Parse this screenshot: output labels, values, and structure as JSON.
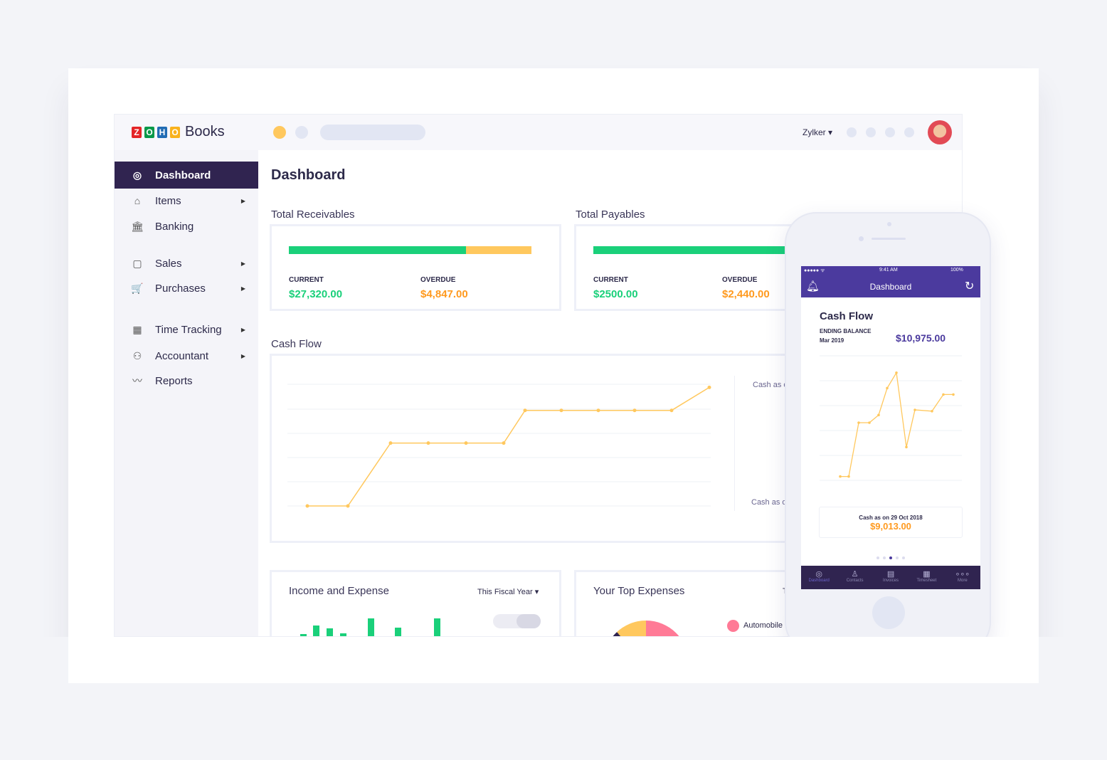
{
  "header": {
    "logo_letters": [
      "Z",
      "O",
      "H",
      "O"
    ],
    "logo_product": "Books",
    "org": "Zylker ▾"
  },
  "colors": {
    "brand_dark": "#302450",
    "green": "#1ad07a",
    "amber": "#ffc85e",
    "orange": "#ff9a1f",
    "phone_purple": "#4b3a9e",
    "pink": "#ff7a96"
  },
  "sidebar": {
    "items": [
      {
        "label": "Dashboard",
        "icon": "dashboard-icon",
        "glyph": "◎",
        "active": true
      },
      {
        "label": "Items",
        "icon": "basket-icon",
        "glyph": "⌂",
        "chevron": true
      },
      {
        "label": "Banking",
        "icon": "bank-icon",
        "glyph": "🏛"
      },
      {
        "label": "Sales",
        "icon": "bag-icon",
        "glyph": "▢",
        "chevron": true
      },
      {
        "label": "Purchases",
        "icon": "cart-icon",
        "glyph": "🛒",
        "chevron": true
      },
      {
        "label": "Time Tracking",
        "icon": "calendar-icon",
        "glyph": "▦",
        "chevron": true
      },
      {
        "label": "Accountant",
        "icon": "person-icon",
        "glyph": "⚇",
        "chevron": true
      },
      {
        "label": "Reports",
        "icon": "chart-icon",
        "glyph": "〰"
      }
    ]
  },
  "main": {
    "title": "Dashboard",
    "receivables": {
      "label": "Total Receivables",
      "current_label": "CURRENT",
      "current": "$27,320.00",
      "overdue_label": "OVERDUE",
      "overdue": "$4,847.00",
      "current_fraction": 0.73
    },
    "payables": {
      "label": "Total Payables",
      "current_label": "CURRENT",
      "current": "$2500.00",
      "overdue_label": "OVERDUE",
      "overdue": "$2,440.00",
      "current_fraction": 0.79
    },
    "cashflow": {
      "label": "Cash Flow",
      "side_top": "Cash as o",
      "side_bottom": "Cash as o"
    },
    "income": {
      "label": "Income and Expense",
      "period": "This Fiscal Year ▾",
      "bars": [
        1,
        3,
        2.4,
        1.2,
        4.6,
        2.5,
        0.2,
        0.2,
        4.6
      ]
    },
    "expenses": {
      "label": "Your Top Expenses",
      "cut": "T",
      "legend": "Automobile E"
    }
  },
  "chart_data": {
    "type": "line",
    "title": "Cash Flow",
    "x": [
      1,
      2,
      3,
      4,
      5,
      6,
      7,
      8,
      9,
      10,
      11,
      12
    ],
    "values": [
      0,
      0,
      52,
      52,
      52,
      52,
      79,
      79,
      79,
      79,
      79,
      98
    ]
  },
  "phone": {
    "status_time": "9:41 AM",
    "battery": "100%",
    "header": "Dashboard",
    "card_title": "Cash Flow",
    "ending_label": "ENDING BALANCE",
    "ending_date": "Mar 2019",
    "ending_value": "$10,975.00",
    "chart_values": [
      8,
      8,
      50,
      50,
      56,
      77,
      89,
      31,
      60,
      59,
      72,
      72
    ],
    "cash_label": "Cash as on  29 Oct 2018",
    "cash_value": "$9,013.00",
    "page_index": 3,
    "page_count": 5,
    "tabs": [
      {
        "label": "Dashboard",
        "glyph": "◎"
      },
      {
        "label": "Contacts",
        "glyph": "♙"
      },
      {
        "label": "Invoices",
        "glyph": "▤"
      },
      {
        "label": "Timesheet",
        "glyph": "▦"
      },
      {
        "label": "More",
        "glyph": "∘∘∘"
      }
    ]
  }
}
